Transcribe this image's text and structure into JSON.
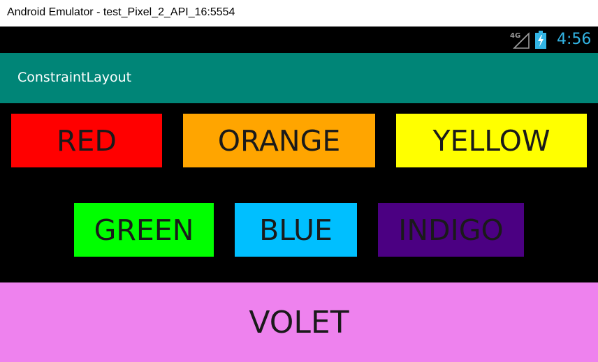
{
  "window": {
    "title": "Android Emulator - test_Pixel_2_API_16:5554"
  },
  "status_bar": {
    "network_label": "4G",
    "time": "4:56",
    "clock_color": "#33b5e5",
    "icons": [
      "signal-4g-icon",
      "battery-charging-icon"
    ]
  },
  "app_bar": {
    "title": "ConstraintLayout",
    "color": "#008577"
  },
  "buttons": [
    {
      "label": "RED",
      "color": "#ff0000"
    },
    {
      "label": "ORANGE",
      "color": "#ffa500"
    },
    {
      "label": "YELLOW",
      "color": "#ffff00"
    },
    {
      "label": "GREEN",
      "color": "#00ff00"
    },
    {
      "label": "BLUE",
      "color": "#00bfff"
    },
    {
      "label": "INDIGO",
      "color": "#4b0082"
    },
    {
      "label": "VOLET",
      "color": "#ee82ee"
    }
  ]
}
